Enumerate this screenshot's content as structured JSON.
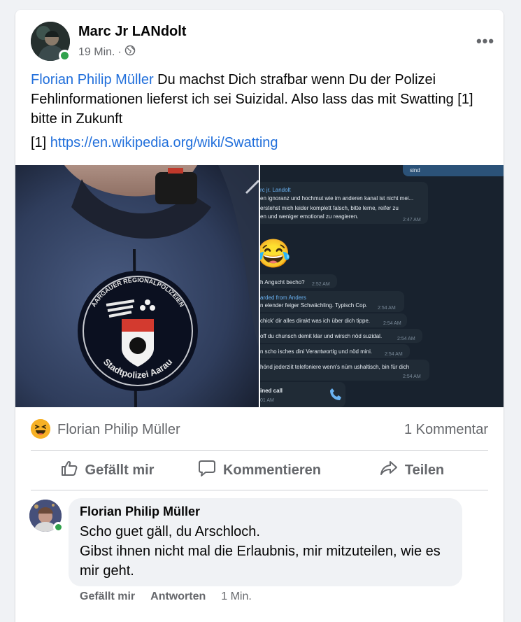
{
  "post": {
    "author": "Marc Jr LANdolt",
    "time": "19 Min.",
    "separator": "·",
    "mention": "Florian Philip Müller",
    "body": " Du machst Dich strafbar wenn Du der Polizei Fehlinformationen lieferst ich sei Suizidal. Also lass das mit Swatting [1] bitte in Zukunft",
    "ref_label": "[1] ",
    "ref_url": "https://en.wikipedia.org/wiki/Swatting"
  },
  "photo_left": {
    "badge_top": "AARGAUER REGIONALPOLIZEIEN",
    "badge_bottom": "Stadtpolizei Aarau"
  },
  "chat": {
    "top_text": "sind",
    "msg1_sender": "rc jr. Landolt",
    "msg1_l1": "en ignoranz und hochmut wie im anderen kanal ist nicht mei...",
    "msg1_l2": "erstehst mich leider komplett falsch, bitte lerne, reifer zu",
    "msg1_l3": "en und weniger emotional zu reagieren.",
    "msg1_time": "2:47 AM",
    "emoji": "😂",
    "m2_text": "h Angscht becho?",
    "m2_time": "2:52 AM",
    "m3_forward": "arded from Anders",
    "m3_text": "n elender feiger Schwächling. Typisch Cop.",
    "m3_time": "2:54 AM",
    "m4_text": "chick' dir alles dirakt was ich über dich tippe.",
    "m4_time": "2:54 AM",
    "m5_text": "off du chunsch demit klar und wirsch nöd suzidal.",
    "m5_time": "2:54 AM",
    "m6_text": "n scho isches dini Verantwortig und nöd mini.",
    "m6_time": "2:54 AM",
    "m7_text": "hönd jederziit telefoniere wenn's nüm ushaltisch, bin für dich",
    "m7_time": "2:54 AM",
    "call_label": "ined call",
    "call_time": "01 AM"
  },
  "reactions": {
    "name": "Florian Philip Müller",
    "comments": "1 Kommentar"
  },
  "actions": {
    "like": "Gefällt mir",
    "comment": "Kommentieren",
    "share": "Teilen"
  },
  "comment": {
    "author": "Florian Philip Müller",
    "line1": "Scho guet gäll, du Arschloch.",
    "line2": "Gibst ihnen nicht mal die Erlaubnis, mir mitzuteilen, wie es mir geht.",
    "like": "Gefällt mir",
    "reply": "Antworten",
    "time": "1 Min."
  },
  "colors": {
    "link": "#216fdb",
    "online": "#31a24c",
    "muted": "#65676b",
    "chat_bg": "#18222e",
    "chat_bubble": "#202b36",
    "chat_accent": "#6ab3f3"
  }
}
